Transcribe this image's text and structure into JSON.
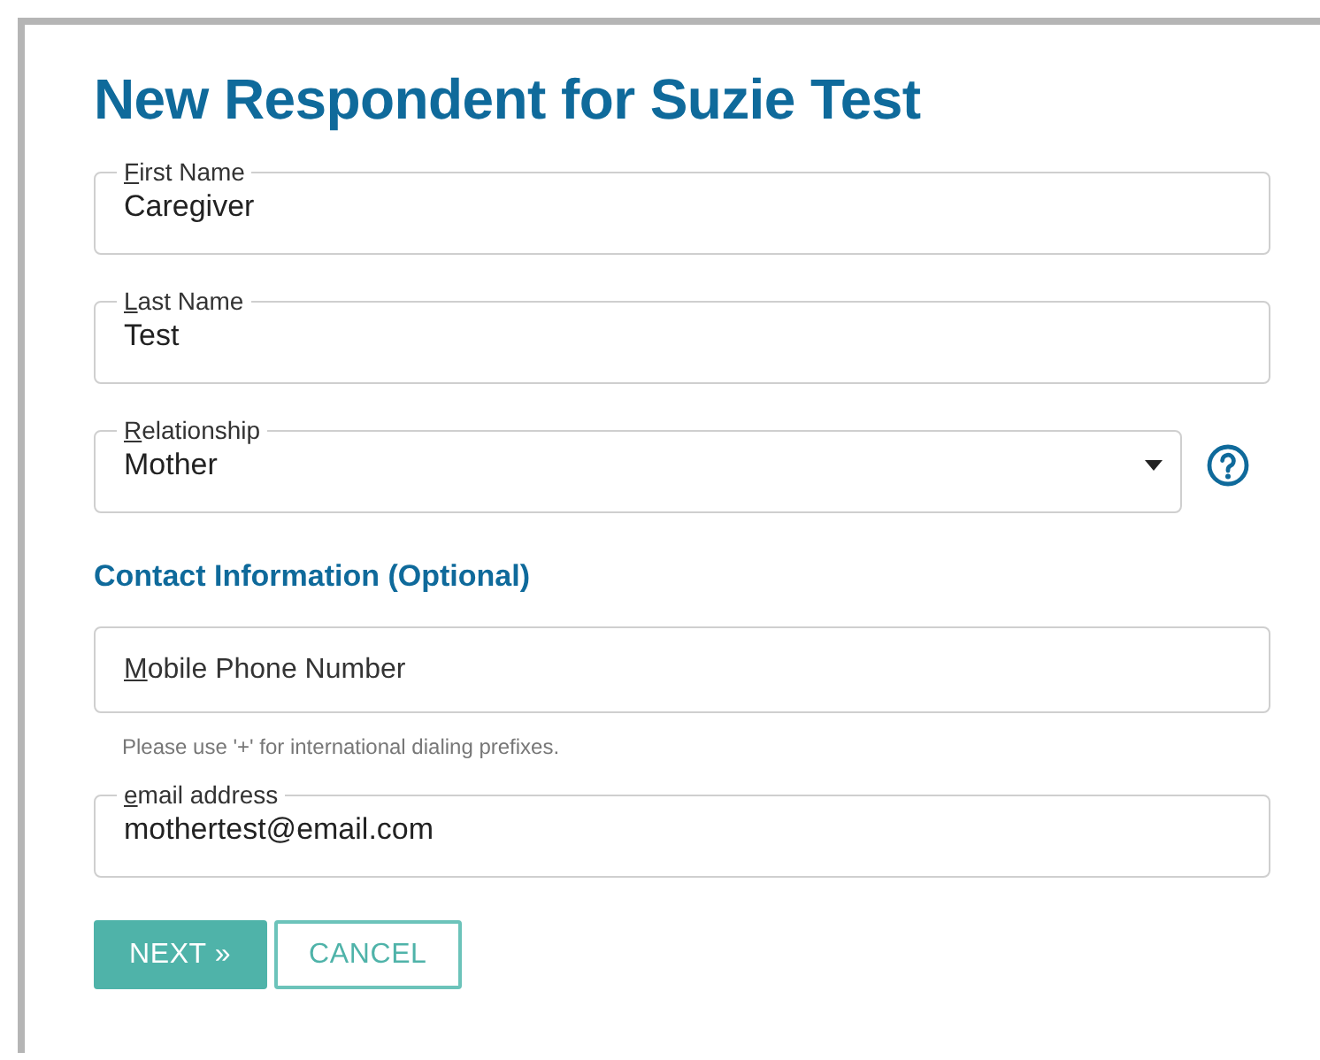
{
  "title": "New Respondent for Suzie Test",
  "fields": [
    {
      "kind": "text",
      "label": "First Name",
      "value": "Caregiver"
    },
    {
      "kind": "text",
      "label": "Last Name",
      "value": "Test"
    },
    {
      "kind": "select",
      "label": "Relationship",
      "value": "Mother",
      "help": true
    }
  ],
  "contact": {
    "heading": "Contact Information (Optional)",
    "fields": [
      {
        "label": "Mobile Phone Number",
        "hint": "Please use '+' for international dialing prefixes."
      },
      {
        "label": "email address",
        "value": "mothertest@email.com"
      }
    ]
  },
  "buttons": [
    {
      "kind": "primary",
      "label": "NEXT »"
    },
    {
      "kind": "secondary",
      "label": "CANCEL"
    }
  ]
}
